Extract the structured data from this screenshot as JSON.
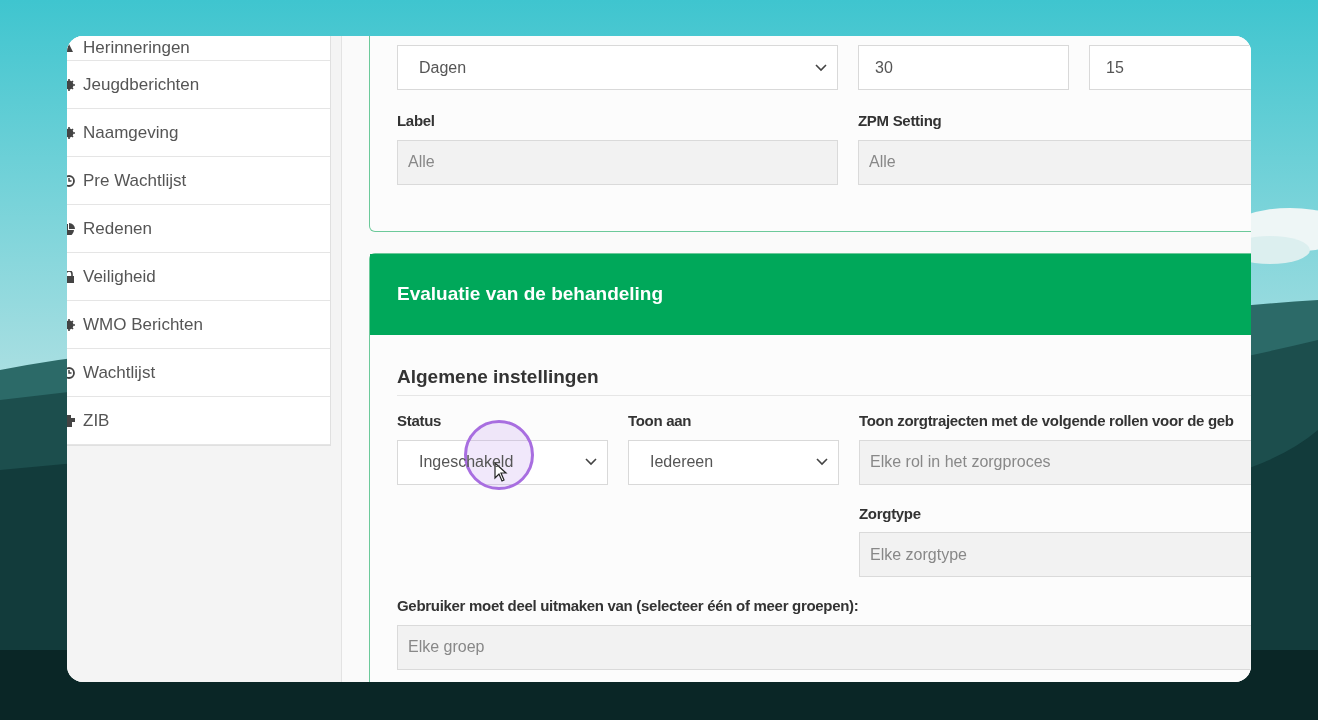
{
  "sidebar": {
    "items": [
      {
        "label": "Herinneringen"
      },
      {
        "label": "Jeugdberichten"
      },
      {
        "label": "Naamgeving"
      },
      {
        "label": "Pre Wachtlijst"
      },
      {
        "label": "Redenen"
      },
      {
        "label": "Veiligheid"
      },
      {
        "label": "WMO Berichten"
      },
      {
        "label": "Wachtlijst"
      },
      {
        "label": "ZIB"
      }
    ]
  },
  "settings_card": {
    "rows": [
      [
        {
          "kind": "select",
          "value": "Dagen"
        },
        {
          "kind": "input",
          "value": "30"
        },
        {
          "kind": "input",
          "value": "15"
        }
      ],
      [
        {
          "kind": "multiselect",
          "label": "Label",
          "placeholder": "Alle"
        },
        {
          "kind": "multiselect",
          "label": "ZPM Setting",
          "placeholder": "Alle"
        }
      ]
    ]
  },
  "evaluation_card": {
    "title": "Evaluatie van de behandeling",
    "section": "Algemene instellingen",
    "fields": [
      {
        "kind": "select",
        "label": "Status",
        "value": "Ingeschakeld"
      },
      {
        "kind": "select",
        "label": "Toon aan",
        "value": "Iedereen"
      },
      {
        "kind": "multiselect",
        "label": "Toon zorgtrajecten met de volgende rollen voor de geb",
        "placeholder": "Elke rol in het zorgproces"
      },
      {
        "kind": "multiselect",
        "label": "Zorgtype",
        "placeholder": "Elke zorgtype"
      },
      {
        "kind": "multiselect",
        "label": "Gebruiker moet deel uitmaken van (selecteer één of meer groepen):",
        "placeholder": "Elke groep"
      }
    ]
  }
}
